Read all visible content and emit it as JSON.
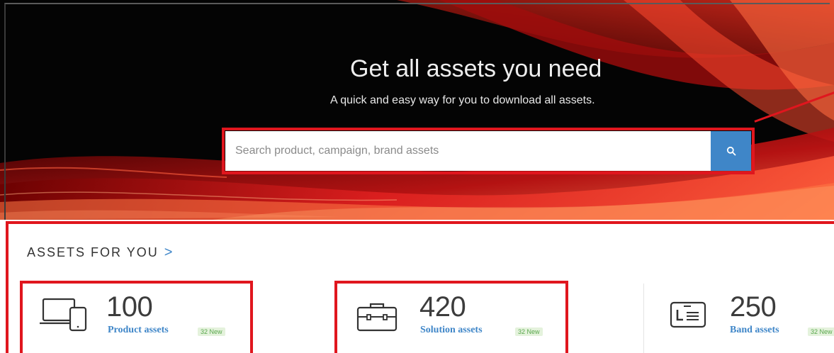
{
  "hero": {
    "title": "Get all assets you need",
    "subtitle": "A quick and easy way for you to download all assets."
  },
  "search": {
    "placeholder": "Search product, campaign, brand assets",
    "value": "",
    "button_icon": "search-icon"
  },
  "assets": {
    "heading": "ASSETS FOR YOU",
    "heading_chevron": ">",
    "cards": [
      {
        "icon": "laptop-tablet-icon",
        "count": "100",
        "label": "Product assets",
        "badge": "32 New"
      },
      {
        "icon": "briefcase-icon",
        "count": "420",
        "label": "Solution assets",
        "badge": "32 New"
      },
      {
        "icon": "brand-card-icon",
        "count": "250",
        "label": "Band assets",
        "badge": "32 New"
      }
    ]
  },
  "colors": {
    "accent_blue": "#3f86c8",
    "highlight_red": "#e0161e",
    "badge_green": "#5aa84e"
  }
}
